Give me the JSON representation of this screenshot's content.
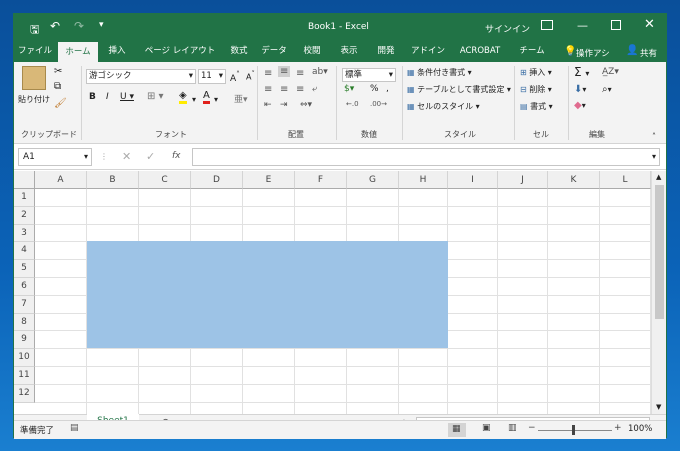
{
  "title": {
    "doc": "Book1  -  Excel",
    "signin": "サインイン"
  },
  "tabs": [
    "ファイル",
    "ホーム",
    "挿入",
    "ページ レイアウト",
    "数式",
    "データ",
    "校閲",
    "表示",
    "開発",
    "アドイン",
    "ACROBAT",
    "チーム"
  ],
  "tell_me": "操作アシ",
  "share": "共有",
  "ribbon": {
    "paste": "貼り付け",
    "font_name": "游ゴシック",
    "font_size": "11",
    "number_format": "標準",
    "cond_format": "条件付き書式",
    "table_format": "テーブルとして書式設定",
    "cell_style": "セルのスタイル",
    "insert": "挿入",
    "delete": "削除",
    "format": "書式",
    "groups": [
      "クリップボード",
      "フォント",
      "配置",
      "数値",
      "スタイル",
      "セル",
      "編集"
    ]
  },
  "formula_bar": {
    "name_box": "A1",
    "fx": "fx",
    "value": ""
  },
  "columns": [
    "A",
    "B",
    "C",
    "D",
    "E",
    "F",
    "G",
    "H",
    "I",
    "J",
    "K",
    "L"
  ],
  "rows": [
    "1",
    "2",
    "3",
    "4",
    "5",
    "6",
    "7",
    "8",
    "9",
    "10",
    "11",
    "12"
  ],
  "selection": {
    "range": "B3:H8",
    "color": "#9dc3e6"
  },
  "sheet_tab": "Sheet1",
  "status": {
    "ready": "準備完了",
    "zoom": "100%"
  }
}
